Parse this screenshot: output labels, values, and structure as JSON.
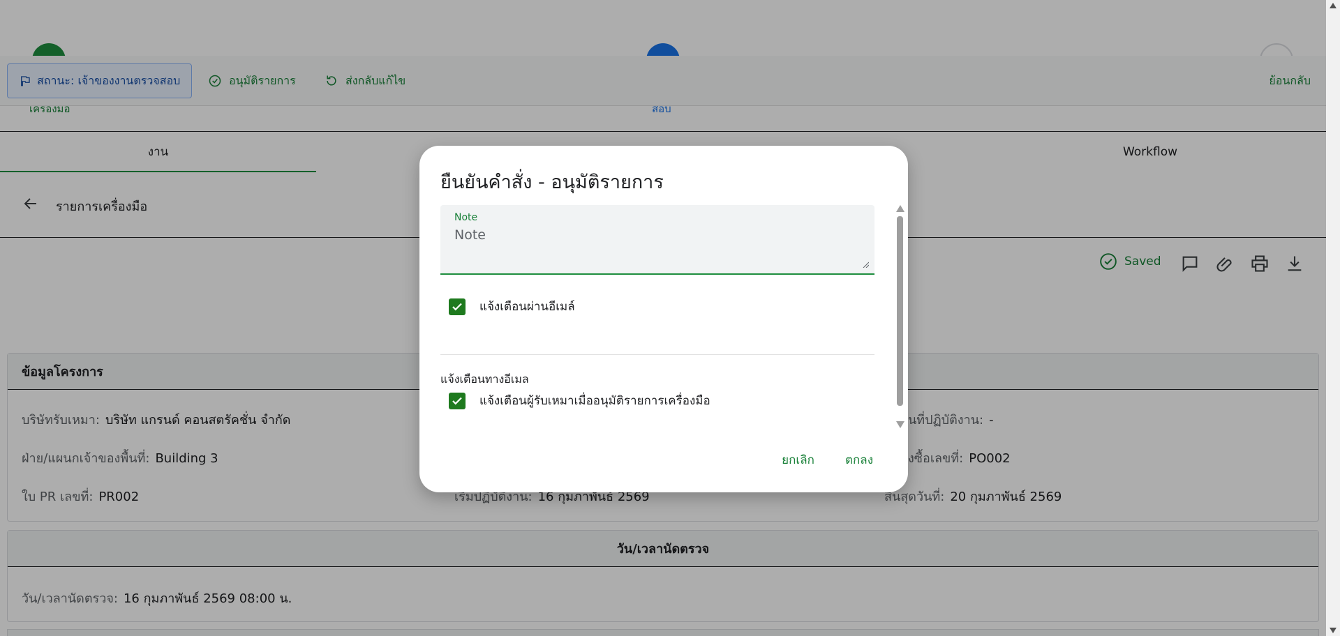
{
  "action_bar": {
    "status_label": "สถานะ: เจ้าของงานตรวจสอบ",
    "approve_label": "อนุมัติรายการ",
    "return_label": "ส่งกลับแก้ไข",
    "back_label": "ย้อนกลับ"
  },
  "stepper": {
    "step1_label": "เครื่องมือ",
    "step2_label": "สอบ"
  },
  "tabs": [
    {
      "label": "งาน"
    },
    {
      "label": "Workflow"
    }
  ],
  "subheader": {
    "title": "รายการเครื่องมือ"
  },
  "toolbar": {
    "saved_label": "Saved"
  },
  "project_card": {
    "header": "ข้อมูลโครงการ",
    "fields": [
      {
        "label": "บริษัทรับเหมา:",
        "value": "บริษัท แกรนด์ คอนสตรัคชั่น จำกัด"
      },
      {
        "label": "นที่ปฏิบัติงาน:",
        "value": "-"
      },
      {
        "label": "ฝ่าย/แผนกเจ้าของพื้นที่:",
        "value": "Building 3"
      },
      {
        "label": "งซื้อเลขที่:",
        "value": "PO002"
      },
      {
        "label": "ใบ PR เลขที่:",
        "value": "PR002"
      },
      {
        "label": "เริ่มปฏิบัติงาน:",
        "value": "16 กุมภาพันธ์ 2569"
      },
      {
        "label": "สิ้นสุดวันที่:",
        "value": "20 กุมภาพันธ์ 2569"
      }
    ]
  },
  "appointment_card": {
    "header": "วัน/เวลานัดตรวจ",
    "label": "วัน/เวลานัดตรวจ:",
    "value": "16 กุมภาพันธ์ 2569 08:00 น."
  },
  "dialog": {
    "title": "ยืนยันคำสั่ง - อนุมัติรายการ",
    "note_label": "Note",
    "note_placeholder": "Note",
    "email_notify_label": "แจ้งเตือนผ่านอีเมล์",
    "section_label": "แจ้งเตือนทางอีเมล",
    "contractor_notify_label": "แจ้งเตือนผู้รับเหมาเมื่ออนุมัติรายการเครื่องมือ",
    "cancel_label": "ยกเลิก",
    "ok_label": "ตกลง"
  },
  "colors": {
    "accent_green": "#188038",
    "checkbox_green": "#1e7a1e",
    "status_blue": "#174ea6"
  },
  "icons": {
    "status": "flag-icon",
    "approve": "check-circle-icon",
    "return": "refresh-icon",
    "back": "arrow-left-icon",
    "saved": "check-circle-icon",
    "comment": "comment-icon",
    "attach": "paperclip-icon",
    "print": "printer-icon",
    "download": "download-icon"
  }
}
